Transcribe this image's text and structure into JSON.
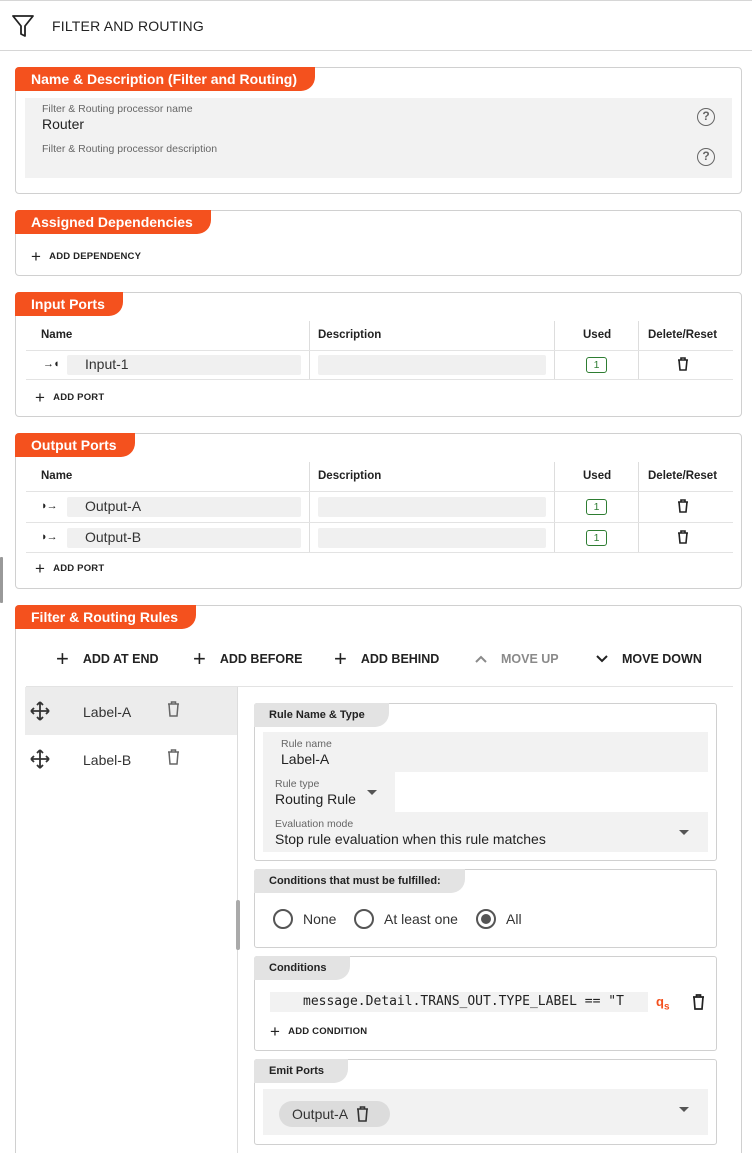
{
  "header": {
    "title": "FILTER AND ROUTING",
    "icon": "filter-icon"
  },
  "name_section": {
    "tag": "Name & Description (Filter and Routing)",
    "name_label": "Filter & Routing processor name",
    "name_value": "Router",
    "desc_label": "Filter & Routing processor description",
    "desc_value": ""
  },
  "dependencies": {
    "tag": "Assigned Dependencies",
    "add_label": "ADD DEPENDENCY"
  },
  "input_ports": {
    "tag": "Input Ports",
    "columns": {
      "name": "Name",
      "description": "Description",
      "used": "Used",
      "delete": "Delete/Reset"
    },
    "rows": [
      {
        "name": "Input-1",
        "description": "",
        "used": "1"
      }
    ],
    "add_label": "ADD PORT"
  },
  "output_ports": {
    "tag": "Output Ports",
    "columns": {
      "name": "Name",
      "description": "Description",
      "used": "Used",
      "delete": "Delete/Reset"
    },
    "rows": [
      {
        "name": "Output-A",
        "description": "",
        "used": "1"
      },
      {
        "name": "Output-B",
        "description": "",
        "used": "1"
      }
    ],
    "add_label": "ADD PORT"
  },
  "rules": {
    "tag": "Filter & Routing Rules",
    "toolbar": {
      "add_at_end": "ADD AT END",
      "add_before": "ADD BEFORE",
      "add_behind": "ADD BEHIND",
      "move_up": "MOVE UP",
      "move_down": "MOVE DOWN"
    },
    "items": [
      {
        "label": "Label-A",
        "selected": true
      },
      {
        "label": "Label-B",
        "selected": false
      }
    ],
    "detail": {
      "name_type_tag": "Rule Name & Type",
      "rule_name_label": "Rule name",
      "rule_name_value": "Label-A",
      "rule_type_label": "Rule type",
      "rule_type_value": "Routing Rule",
      "eval_label": "Evaluation mode",
      "eval_value": "Stop rule evaluation when this rule matches",
      "conditions_tag": "Conditions that must be fulfilled:",
      "radio_none": "None",
      "radio_at_least_one": "At least one",
      "radio_all": "All",
      "radio_selected": "All",
      "conditions_list_tag": "Conditions",
      "condition_expr": "message.Detail.TRANS_OUT.TYPE_LABEL == \"T",
      "qs_glyph": "qs",
      "add_condition": "ADD CONDITION",
      "emit_tag": "Emit Ports",
      "emit_chip": "Output-A"
    }
  },
  "colors": {
    "accent": "#f4511e",
    "used_badge": "#2e7d32"
  }
}
